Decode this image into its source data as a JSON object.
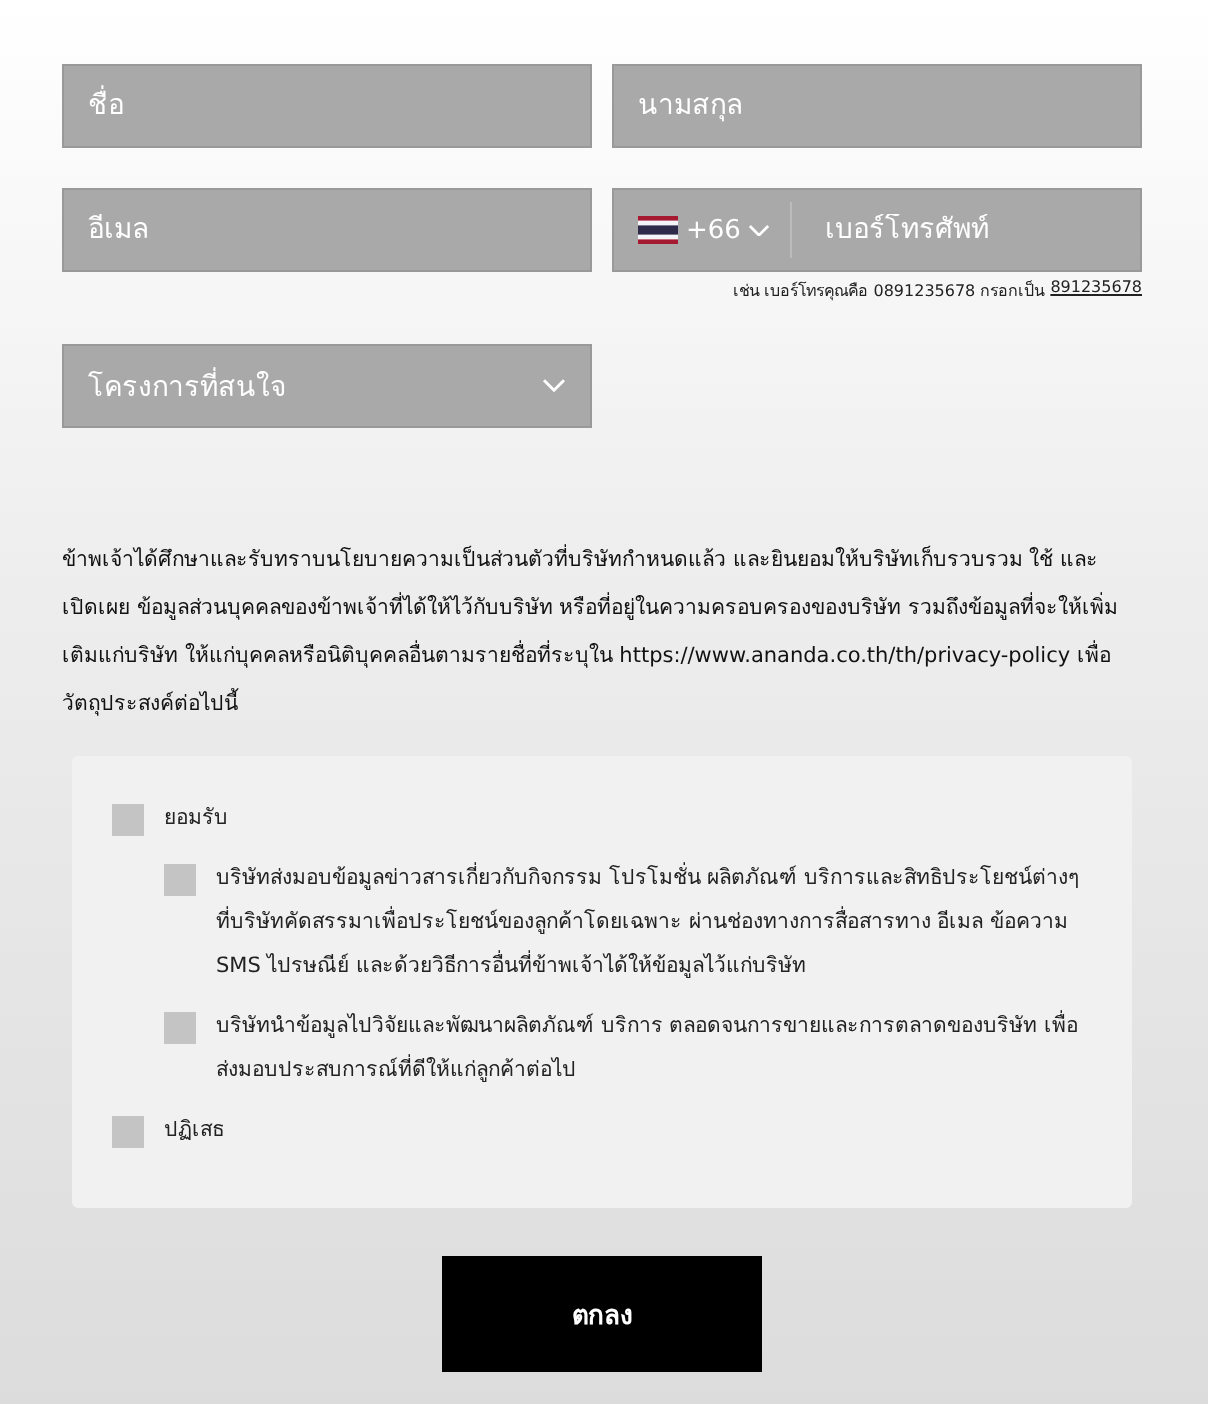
{
  "fields": [
    {
      "kind": "text",
      "placeholder": "ชื่อ"
    },
    {
      "kind": "text",
      "placeholder": "นามสกุล"
    },
    {
      "kind": "text",
      "placeholder": "อีเมล"
    },
    {
      "kind": "phone",
      "country_code": "+66",
      "placeholder": "เบอร์โทรศัพท์",
      "hint": "เช่น เบอร์โทรคุณคือ 0891235678 กรอกเป็น",
      "hint_example": "891235678"
    },
    {
      "kind": "select",
      "placeholder": "โครงการที่สนใจ"
    }
  ],
  "consent_text": "ข้าพเจ้าได้ศึกษาและรับทราบนโยบายความเป็นส่วนตัวที่บริษัทกำหนดแล้ว และยินยอมให้บริษัทเก็บรวบรวม ใช้ และเปิดเผย ข้อมูลส่วนบุคคลของข้าพเจ้าที่ได้ให้ไว้กับบริษัท หรือที่อยู่ในความครอบครองของบริษัท รวมถึงข้อมูลที่จะให้เพิ่มเติมแก่บริษัท ให้แก่บุคคลหรือนิติบุคคลอื่นตามรายชื่อที่ระบุใน https://www.ananda.co.th/th/privacy-policy เพื่อวัตถุประสงค์ต่อไปนี้",
  "options": [
    {
      "label": "ยอมรับ",
      "checked": false,
      "children": [
        {
          "label": "บริษัทส่งมอบข้อมูลข่าวสารเกี่ยวกับกิจกรรม โปรโมชั่น ผลิตภัณฑ์ บริการและสิทธิประโยชน์ต่างๆ ที่บริษัทคัดสรรมาเพื่อประโยชน์ของลูกค้าโดยเฉพาะ ผ่านช่องทางการสื่อสารทาง อีเมล ข้อความ SMS ไปรษณีย์ และด้วยวิธีการอื่นที่ข้าพเจ้าได้ให้ข้อมูลไว้แก่บริษัท",
          "checked": false
        },
        {
          "label": "บริษัทนำข้อมูลไปวิจัยและพัฒนาผลิตภัณฑ์ บริการ ตลอดจนการขายและการตลาดของบริษัท เพื่อส่งมอบประสบการณ์ที่ดีให้แก่ลูกค้าต่อไป",
          "checked": false
        }
      ]
    },
    {
      "label": "ปฏิเสธ",
      "checked": false
    }
  ],
  "submit": "ตกลง"
}
